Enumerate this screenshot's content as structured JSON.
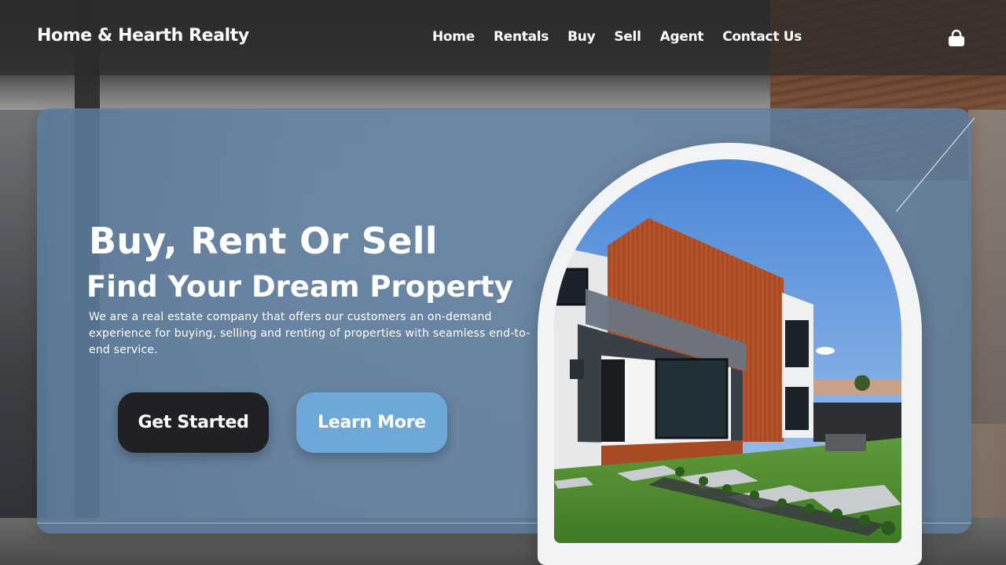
{
  "header": {
    "brand": "Home & Hearth Realty",
    "nav": [
      {
        "label": "Home"
      },
      {
        "label": "Rentals"
      },
      {
        "label": "Buy"
      },
      {
        "label": "Sell"
      },
      {
        "label": "Agent"
      },
      {
        "label": "Contact Us"
      }
    ],
    "user_icon": "user-lock-icon"
  },
  "hero": {
    "headline": "Buy, Rent Or Sell",
    "subheadline": "Find Your Dream Property",
    "description": "We are a real estate company that offers our customers an on-demand experience for buying, selling and renting of properties with seamless end-to-end service.",
    "primary_button": "Get Started",
    "secondary_button": "Learn More"
  },
  "colors": {
    "hero_card": "#5d7d9e",
    "primary_button": "#1f2124",
    "secondary_button": "#6ea8d9",
    "header_bg": "#2d2d2d",
    "text": "#ffffff"
  }
}
